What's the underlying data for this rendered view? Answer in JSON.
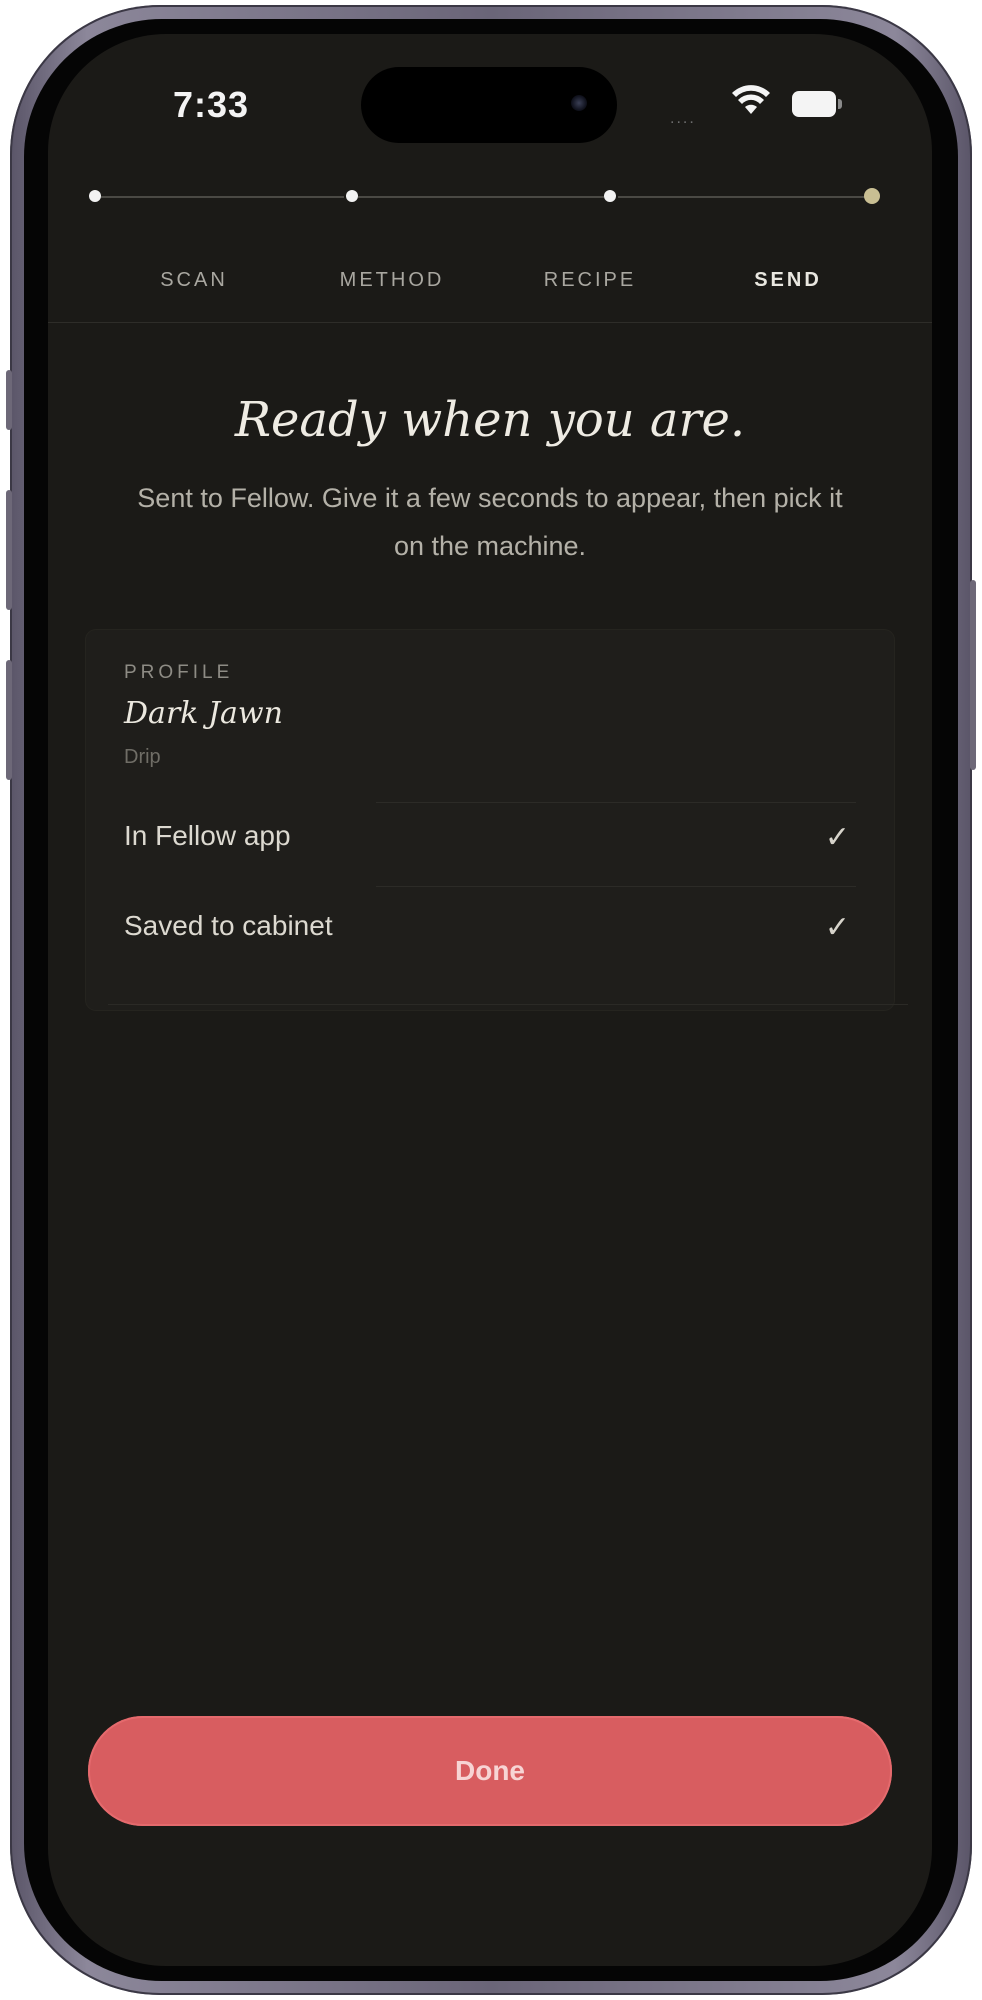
{
  "status_bar": {
    "time": "7:33",
    "signal": "....",
    "wifi_icon": "wifi-icon",
    "battery_icon": "battery-icon"
  },
  "stepper": {
    "steps": [
      {
        "label": "SCAN",
        "active": false
      },
      {
        "label": "METHOD",
        "active": false
      },
      {
        "label": "RECIPE",
        "active": false
      },
      {
        "label": "SEND",
        "active": true
      }
    ]
  },
  "main": {
    "headline": "Ready when you are.",
    "subtext": "Sent to Fellow. Give it a few seconds to appear, then pick it on the machine."
  },
  "card": {
    "section_label": "PROFILE",
    "profile_name": "Dark Jawn",
    "profile_method": "Drip",
    "rows": [
      {
        "label": "In Fellow app",
        "check": "✓"
      },
      {
        "label": "Saved to cabinet",
        "check": "✓"
      }
    ]
  },
  "actions": {
    "done_label": "Done"
  },
  "colors": {
    "screen_bg": "#1b1a17",
    "accent_active_step": "#c9bf93",
    "done_button": "#d85d60"
  }
}
